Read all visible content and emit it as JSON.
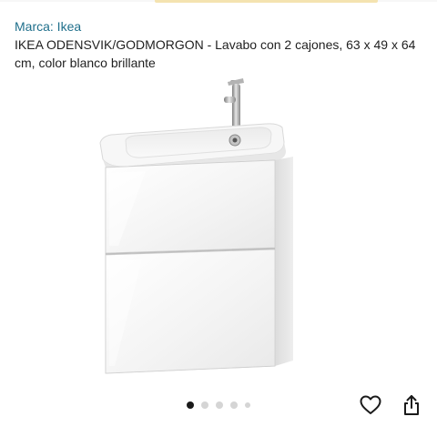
{
  "product": {
    "brand_link": "Marca: Ikea",
    "title": "IKEA ODENSVIK/GODMORGON - Lavabo con 2 cajones, 63 x 49 x 64 cm, color blanco brillante"
  },
  "carousel": {
    "dot_count": 5,
    "active_index": 0
  },
  "actions": {
    "favorite_icon": "heart-outline-icon",
    "share_icon": "share-icon"
  },
  "colors": {
    "brand_link": "#1f6f8b",
    "active_dot": "#1a1a1a",
    "inactive_dot": "#d5d5d5"
  }
}
